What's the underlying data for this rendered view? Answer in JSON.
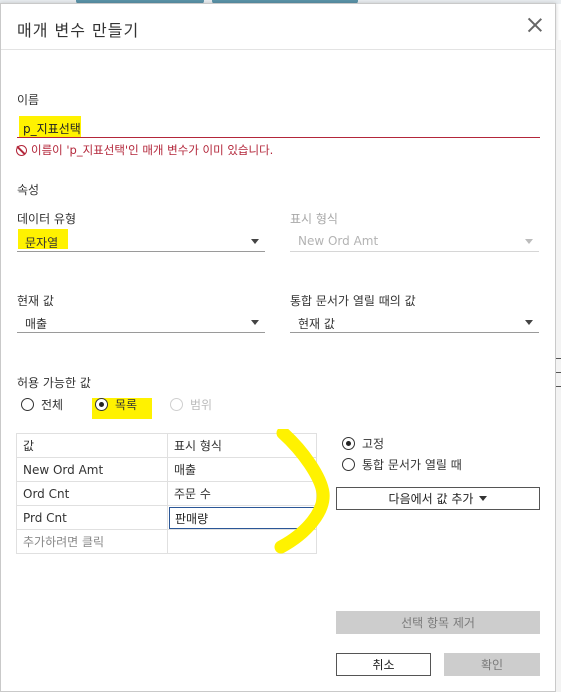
{
  "dialog": {
    "title": "매개 변수 만들기",
    "name_label": "이름",
    "name_value": "p_지표선택",
    "error_text": "이름이 'p_지표선택'인 매개 변수가 이미 있습니다.",
    "properties_label": "속성",
    "data_type_label": "데이터 유형",
    "data_type_value": "문자열",
    "display_format_label": "표시 형식",
    "display_format_value": "New Ord Amt",
    "current_value_label": "현재 값",
    "current_value": "매출",
    "workbook_open_label": "통합 문서가 열릴 때의 값",
    "workbook_open_value": "현재 값",
    "allowable_label": "허용 가능한 값",
    "allowable_options": [
      "전체",
      "목록",
      "범위"
    ],
    "allowable_selected": "목록",
    "table": {
      "headers": [
        "값",
        "표시 형식"
      ],
      "rows": [
        [
          "New Ord Amt",
          "매출"
        ],
        [
          "Ord Cnt",
          "주문 수"
        ],
        [
          "Prd Cnt",
          "판매량"
        ]
      ],
      "add_placeholder": "추가하려면 클릭"
    },
    "list_mode_options": [
      "고정",
      "통합 문서가 열릴 때"
    ],
    "list_mode_selected": "고정",
    "add_values_button": "다음에서 값 추가",
    "remove_selected_button": "선택 항목 제거",
    "cancel_button": "취소",
    "ok_button": "확인"
  },
  "colors": {
    "highlight": "#fff200",
    "error": "#b3263a",
    "edit_border": "#2b5797"
  }
}
